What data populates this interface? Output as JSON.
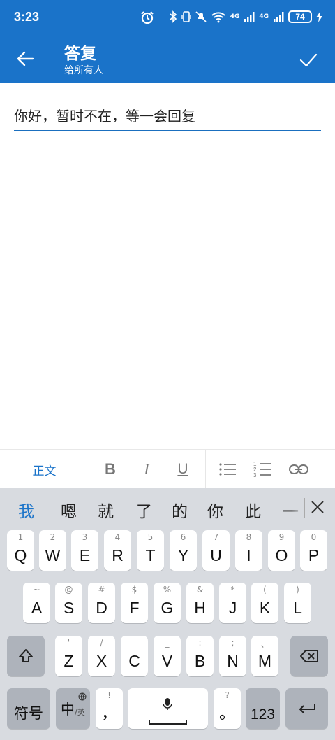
{
  "status": {
    "time": "3:23",
    "net1": "4G",
    "net2": "4G",
    "battery": "74"
  },
  "appbar": {
    "title": "答复",
    "subtitle": "给所有人"
  },
  "editor": {
    "text": "你好，暂时不在，等一会回复"
  },
  "format_toolbar": {
    "style_label": "正文",
    "bold": "B",
    "italic": "I",
    "underline": "U"
  },
  "keyboard": {
    "candidates": [
      "我",
      "嗯",
      "就",
      "了",
      "的",
      "你",
      "此",
      "一"
    ],
    "row1": [
      {
        "main": "Q",
        "sub": "1"
      },
      {
        "main": "W",
        "sub": "2"
      },
      {
        "main": "E",
        "sub": "3"
      },
      {
        "main": "R",
        "sub": "4"
      },
      {
        "main": "T",
        "sub": "5"
      },
      {
        "main": "Y",
        "sub": "6"
      },
      {
        "main": "U",
        "sub": "7"
      },
      {
        "main": "I",
        "sub": "8"
      },
      {
        "main": "O",
        "sub": "9"
      },
      {
        "main": "P",
        "sub": "0"
      }
    ],
    "row2": [
      {
        "main": "A",
        "sub": "~"
      },
      {
        "main": "S",
        "sub": "@"
      },
      {
        "main": "D",
        "sub": "#"
      },
      {
        "main": "F",
        "sub": "$"
      },
      {
        "main": "G",
        "sub": "%"
      },
      {
        "main": "H",
        "sub": "&"
      },
      {
        "main": "J",
        "sub": "*"
      },
      {
        "main": "K",
        "sub": "("
      },
      {
        "main": "L",
        "sub": ")"
      }
    ],
    "row3": [
      {
        "main": "Z",
        "sub": "'"
      },
      {
        "main": "X",
        "sub": "/"
      },
      {
        "main": "C",
        "sub": "-"
      },
      {
        "main": "V",
        "sub": "_"
      },
      {
        "main": "B",
        "sub": ":"
      },
      {
        "main": "N",
        "sub": ";"
      },
      {
        "main": "M",
        "sub": "、"
      }
    ],
    "symbols_label": "符号",
    "lang_label": "中",
    "lang_sub": "/英",
    "comma": "，",
    "comma_sub": "!",
    "period": "。",
    "period_sub": "?",
    "numbers_label": "123"
  }
}
